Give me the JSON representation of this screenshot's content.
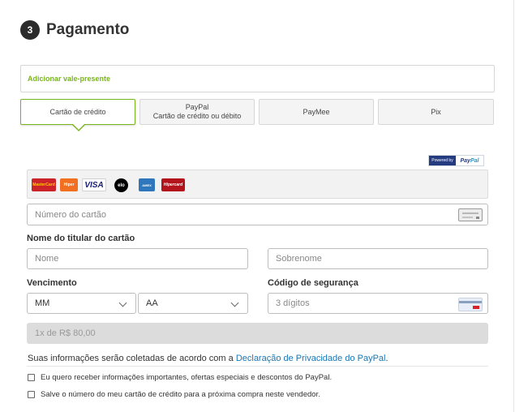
{
  "step": {
    "number": "3",
    "title": "Pagamento"
  },
  "gift": {
    "label": "Adicionar vale-presente"
  },
  "tabs": [
    {
      "label": "Cartão de crédito",
      "sub": "",
      "active": true
    },
    {
      "label": "PayPal",
      "sub": "Cartão de crédito ou débito",
      "active": false
    },
    {
      "label": "PayMee",
      "sub": "",
      "active": false
    },
    {
      "label": "Pix",
      "sub": "",
      "active": false
    }
  ],
  "powered": {
    "prefix": "Powered by",
    "brand_a": "Pay",
    "brand_b": "Pal"
  },
  "brands": [
    {
      "name": "mastercard-logo",
      "text": "MasterCard",
      "bg": "#cc2229",
      "fg": "#ffcc00"
    },
    {
      "name": "hipercard-logo-hiper",
      "text": "Hiper",
      "bg": "#f26f21",
      "fg": "#ffffff"
    },
    {
      "name": "visa-logo",
      "text": "VISA",
      "bg": "#ffffff",
      "fg": "#1a1f71"
    },
    {
      "name": "elo-logo",
      "text": "elo",
      "bg": "#000000",
      "fg": "#ffffff"
    },
    {
      "name": "amex-logo",
      "text": "AMEX",
      "bg": "#2e77bc",
      "fg": "#ffffff"
    },
    {
      "name": "hipercard-logo",
      "text": "Hipercard",
      "bg": "#b3131b",
      "fg": "#ffffff"
    }
  ],
  "card_number": {
    "placeholder": "Número do cartão"
  },
  "holder": {
    "label": "Nome do titular do cartão",
    "first_placeholder": "Nome",
    "last_placeholder": "Sobrenome"
  },
  "expiry": {
    "label": "Vencimento",
    "month": "MM",
    "year": "AA"
  },
  "cvv": {
    "label": "Código de segurança",
    "placeholder": "3 dígitos"
  },
  "installment": {
    "value": "1x de R$ 80,00"
  },
  "privacy": {
    "text": "Suas informações serão coletadas de acordo com a ",
    "link": "Declaração de Privacidade do PayPal",
    "end": "."
  },
  "checkboxes": [
    {
      "label": "Eu quero receber informações importantes, ofertas especiais e descontos do PayPal."
    },
    {
      "label": "Salve o número do meu cartão de crédito para a próxima compra neste vendedor."
    }
  ],
  "colors": {
    "accent": "#79b51c",
    "link": "#1976b4",
    "paypal_dark": "#253b80",
    "paypal_light": "#179bd7"
  }
}
